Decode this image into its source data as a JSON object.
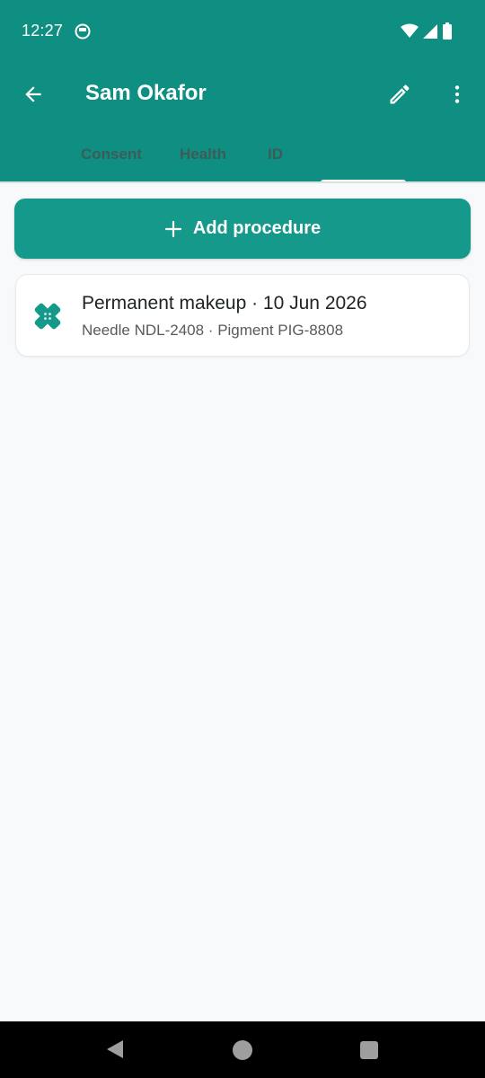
{
  "status_bar": {
    "time": "12:27",
    "icons": [
      "app-notification-icon",
      "wifi-icon",
      "signal-icon",
      "battery-icon"
    ]
  },
  "app_bar": {
    "title": "Sam Okafor",
    "icons": [
      "arrow-back-icon",
      "pencil-icon",
      "more-vert-icon"
    ],
    "tabs": [
      {
        "label": "Consent"
      },
      {
        "label": "Health"
      },
      {
        "label": "ID"
      },
      {
        "label": ""
      }
    ],
    "selected_tab_index": 3
  },
  "actions": {
    "add_label": "Add procedure",
    "add_icon": "plus-icon"
  },
  "procedures": [
    {
      "title": "Permanent makeup · 10 Jun 2026",
      "subtitle": "Needle NDL-2408 · Pigment PIG-8808",
      "icon": "bandage-icon"
    }
  ],
  "colors": {
    "primary": "#0e8f82",
    "button": "#14998b",
    "background": "#f7f9fb",
    "tab_text": "#3d5c57"
  },
  "nav_bar": {
    "icons": [
      "nav-back-icon",
      "nav-home-icon",
      "nav-recents-icon"
    ]
  }
}
